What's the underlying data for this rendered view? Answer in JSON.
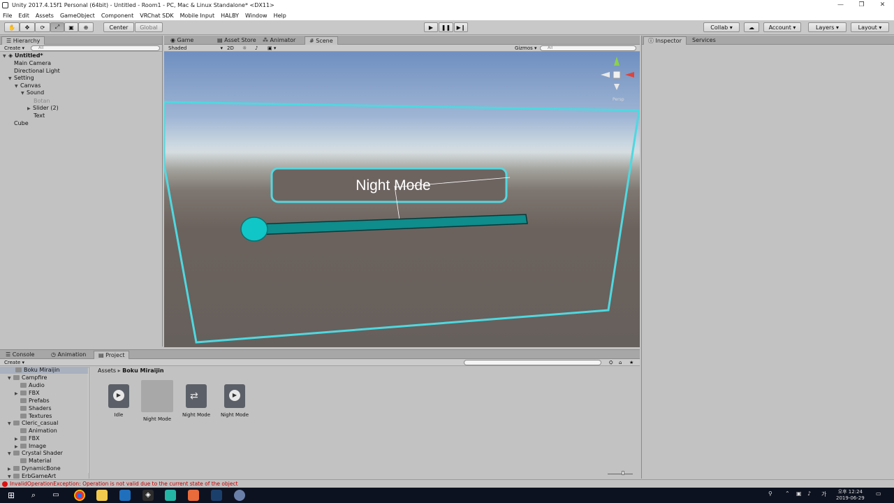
{
  "window": {
    "title": "Unity 2017.4.15f1 Personal (64bit) - Untitled - Room1 - PC, Mac & Linux Standalone* <DX11>",
    "controls": [
      "—",
      "❐",
      "✕"
    ]
  },
  "menu": [
    "File",
    "Edit",
    "Assets",
    "GameObject",
    "Component",
    "VRChat SDK",
    "Mobile Input",
    "HALBY",
    "Window",
    "Help"
  ],
  "toolbar": {
    "pivot": "Center",
    "space": "Global",
    "collab": "Collab",
    "account": "Account",
    "layers": "Layers",
    "layout": "Layout"
  },
  "hierarchy": {
    "tab": "Hierarchy",
    "create": "Create",
    "search_placeholder": "All",
    "scene_name": "Untitled*",
    "items": [
      "Main Camera",
      "Directional Light",
      "Setting",
      "Canvas",
      "Sound",
      "Botan",
      "Slider (2)",
      "Text",
      "Cube"
    ]
  },
  "scene": {
    "tabs": [
      "Game",
      "Asset Store",
      "Animator",
      "Scene"
    ],
    "shading": "Shaded",
    "mode_2d": "2D",
    "gizmos": "Gizmos",
    "search_placeholder": "All",
    "persp_label": "Persp",
    "button_text": "Night Mode",
    "colors": {
      "outline": "#4fd8e0",
      "slider_fill": "#0f8c8c",
      "handle": "#10c6c6"
    }
  },
  "inspector": {
    "tabs": [
      "Inspector",
      "Services"
    ]
  },
  "project": {
    "tabs": [
      "Console",
      "Animation",
      "Project"
    ],
    "create": "Create",
    "breadcrumb": {
      "root": "Assets",
      "current": "Boku Miraijin"
    },
    "tree": [
      "Boku Miraijin",
      "Campfire",
      "Audio",
      "FBX",
      "Prefabs",
      "Shaders",
      "Textures",
      "Cleric_casual",
      "Animation",
      "FBX",
      "Image",
      "Crystal Shader",
      "Material",
      "DynamicBone",
      "ErbGameArt"
    ],
    "assets": [
      "Idle",
      "Night Mode",
      "Night Mode",
      "Night Mode"
    ]
  },
  "status": {
    "error": "InvalidOperationException: Operation is not valid due to the current state of the object"
  },
  "taskbar": {
    "time": "오후 12:24",
    "date": "2019-06-29"
  }
}
